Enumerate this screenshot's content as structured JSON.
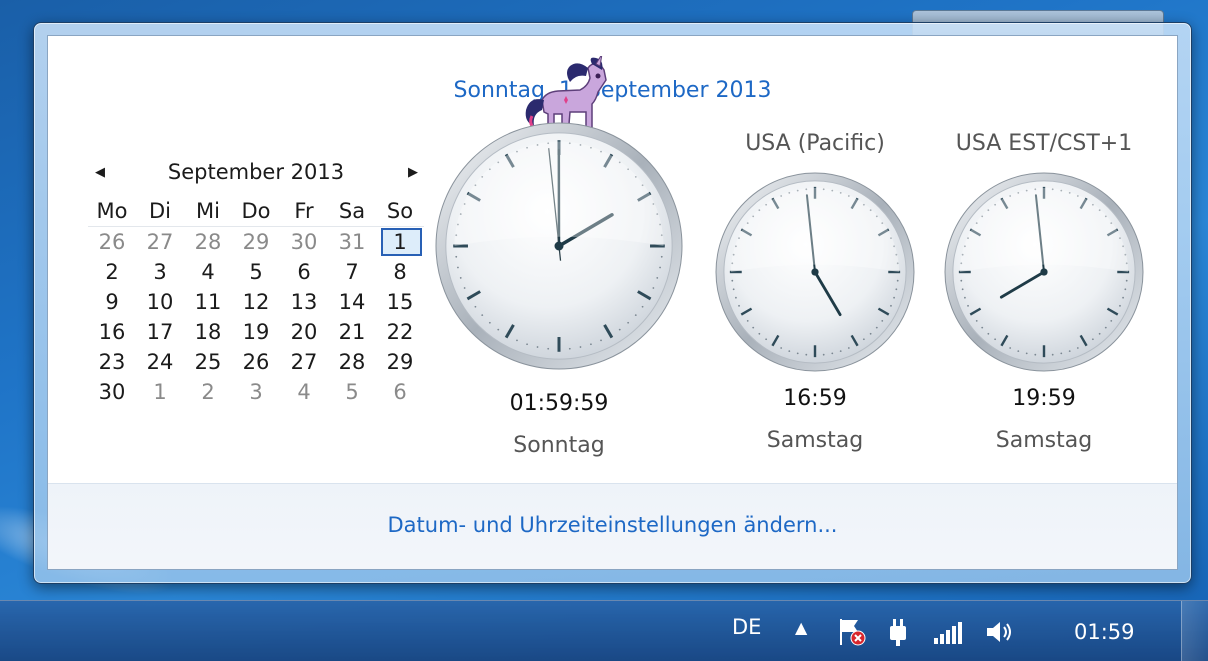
{
  "flyout": {
    "date_title": "Sonntag, 1. September 2013",
    "footer_link": "Datum- und Uhrzeiteinstellungen ändern..."
  },
  "calendar": {
    "month_label": "September 2013",
    "prev_icon": "left-arrow-icon",
    "next_icon": "right-arrow-icon",
    "weekdays": [
      "Mo",
      "Di",
      "Mi",
      "Do",
      "Fr",
      "Sa",
      "So"
    ],
    "weeks": [
      [
        "26",
        "27",
        "28",
        "29",
        "30",
        "31",
        "1"
      ],
      [
        "2",
        "3",
        "4",
        "5",
        "6",
        "7",
        "8"
      ],
      [
        "9",
        "10",
        "11",
        "12",
        "13",
        "14",
        "15"
      ],
      [
        "16",
        "17",
        "18",
        "19",
        "20",
        "21",
        "22"
      ],
      [
        "23",
        "24",
        "25",
        "26",
        "27",
        "28",
        "29"
      ],
      [
        "30",
        "1",
        "2",
        "3",
        "4",
        "5",
        "6"
      ]
    ],
    "selected_day": "1"
  },
  "clocks": [
    {
      "label": "",
      "time": "01:59:59",
      "day": "Sonntag",
      "hours": 1,
      "minutes": 59,
      "seconds": 59
    },
    {
      "label": "USA (Pacific)",
      "time": "16:59",
      "day": "Samstag",
      "hours": 16,
      "minutes": 59
    },
    {
      "label": "USA EST/CST+1",
      "time": "19:59",
      "day": "Samstag",
      "hours": 19,
      "minutes": 59
    }
  ],
  "taskbar": {
    "language": "DE",
    "show_hidden_icon": "up-arrow-icon",
    "tray_icons": [
      "action-center-flag-icon",
      "power-plug-icon",
      "network-signal-icon",
      "volume-icon"
    ],
    "clock": "01:59"
  },
  "colors": {
    "link": "#1d68c5",
    "taskbar": "#1f4f8f"
  }
}
